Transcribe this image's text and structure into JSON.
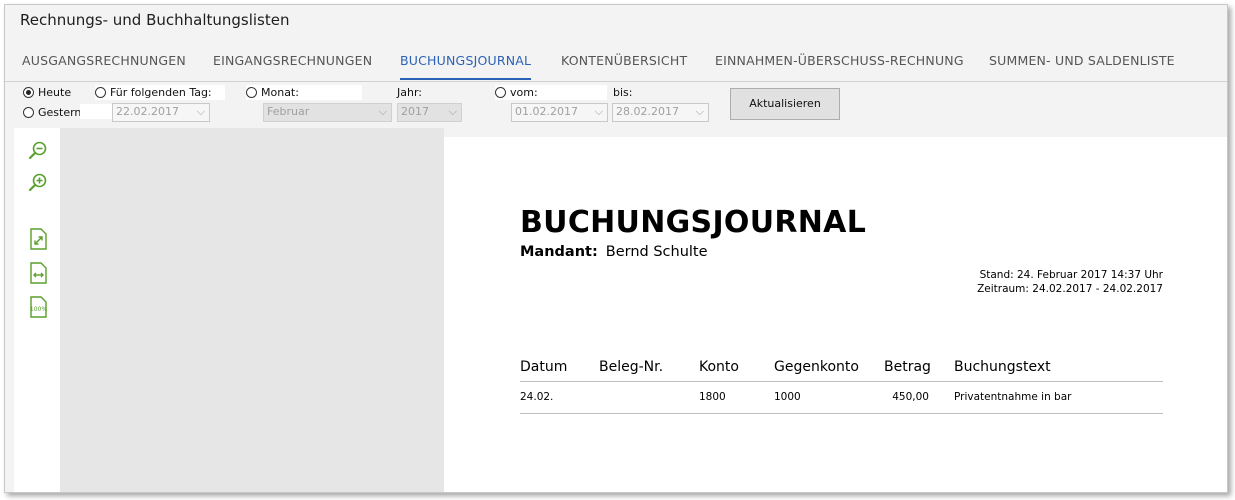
{
  "window": {
    "title": "Rechnungs- und Buchhaltungslisten"
  },
  "tabs": [
    {
      "label": "AUSGANGSRECHNUNGEN"
    },
    {
      "label": "EINGANGSRECHNUNGEN"
    },
    {
      "label": "BUCHUNGSJOURNAL"
    },
    {
      "label": "KONTENÜBERSICHT"
    },
    {
      "label": "EINNAHMEN-ÜBERSCHUSS-RECHNUNG"
    },
    {
      "label": "SUMMEN- UND SALDENLISTE"
    }
  ],
  "active_tab": "BUCHUNGSJOURNAL",
  "filter": {
    "heute": "Heute",
    "gestern": "Gestern",
    "tag_label": "Für folgenden Tag:",
    "tag_value": "22.02.2017",
    "monat_label": "Monat:",
    "monat_value": "Februar",
    "jahr_label": "Jahr:",
    "jahr_value": "2017",
    "vom_label": "vom:",
    "vom_value": "01.02.2017",
    "bis_label": "bis:",
    "bis_value": "28.02.2017",
    "refresh": "Aktualisieren"
  },
  "toolbar": {
    "zoom_out": "zoom-out-icon",
    "zoom_in": "zoom-in-icon",
    "fit_page": "fit-page-icon",
    "fit_width": "fit-width-icon",
    "zoom_100": "100%"
  },
  "report": {
    "title": "BUCHUNGSJOURNAL",
    "mandant_label": "Mandant:",
    "mandant_value": "Bernd Schulte",
    "stand": "Stand:  24. Februar 2017 14:37 Uhr",
    "zeitraum": "Zeitraum: 24.02.2017 - 24.02.2017",
    "columns": [
      "Datum",
      "Beleg-Nr.",
      "Konto",
      "Gegenkonto",
      "Betrag",
      "Buchungstext"
    ],
    "rows": [
      {
        "datum": "24.02.",
        "beleg": "",
        "konto": "1800",
        "gegenkonto": "1000",
        "betrag": "450,00",
        "text": "Privatentnahme in bar"
      }
    ]
  },
  "colors": {
    "accent": "#2b62b5",
    "icon_green": "#5aa02c"
  }
}
